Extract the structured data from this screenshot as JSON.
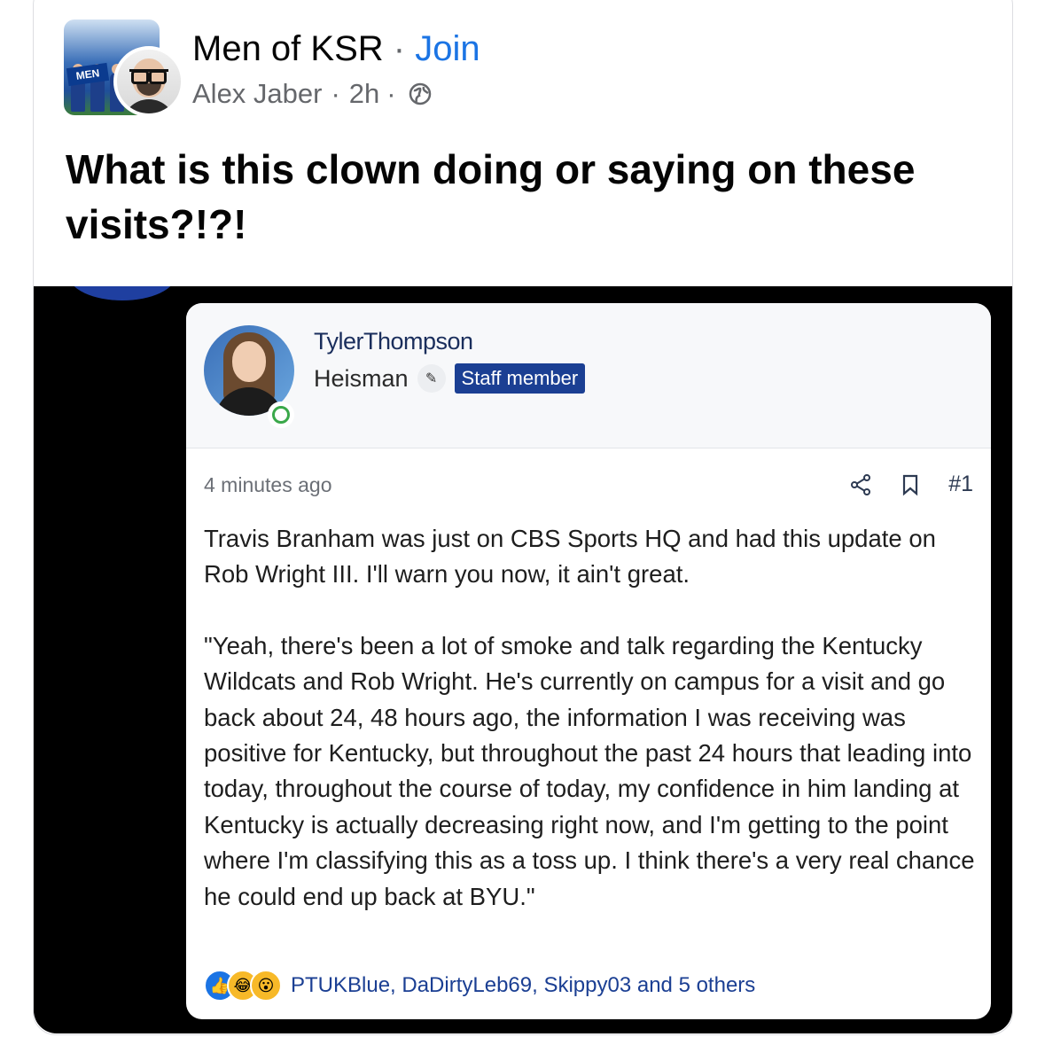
{
  "header": {
    "group_name": "Men of KSR",
    "separator": "·",
    "join_label": "Join",
    "author": "Alex Jaber",
    "dot": "·",
    "time": "2h",
    "group_avatar_logo": "MEN",
    "visibility_icon": "globe-icon"
  },
  "post": {
    "text": "What is this clown doing or saying on these visits?!?!"
  },
  "screenshot": {
    "username": "TylerThompson",
    "rank": "Heisman",
    "rank_icon": "person-pencil-icon",
    "badge": "Staff member",
    "timestamp": "4 minutes ago",
    "post_number": "#1",
    "paragraph1": "Travis Branham was just on CBS Sports HQ and had this update on Rob Wright III. I'll warn you now, it ain't great.",
    "paragraph2": "\"Yeah, there's been a lot of smoke and talk regarding the Kentucky Wildcats and Rob Wright. He's currently on campus for a visit and go back about 24, 48 hours ago, the information I was receiving was positive for Kentucky, but throughout the past 24 hours that leading into today, throughout the course of today, my confidence in him landing at Kentucky is actually decreasing right now, and I'm getting to the point where I'm classifying this as a toss up. I think there's a very real chance he could end up back at BYU.\"",
    "reactions_text": "PTUKBlue, DaDirtyLeb69, Skippy03 and 5 others",
    "reaction_icons": [
      "like-icon",
      "haha-icon",
      "wow-icon"
    ]
  },
  "colors": {
    "join": "#1b74e4",
    "staff_badge": "#1b3f93",
    "media_bg": "#000000"
  }
}
